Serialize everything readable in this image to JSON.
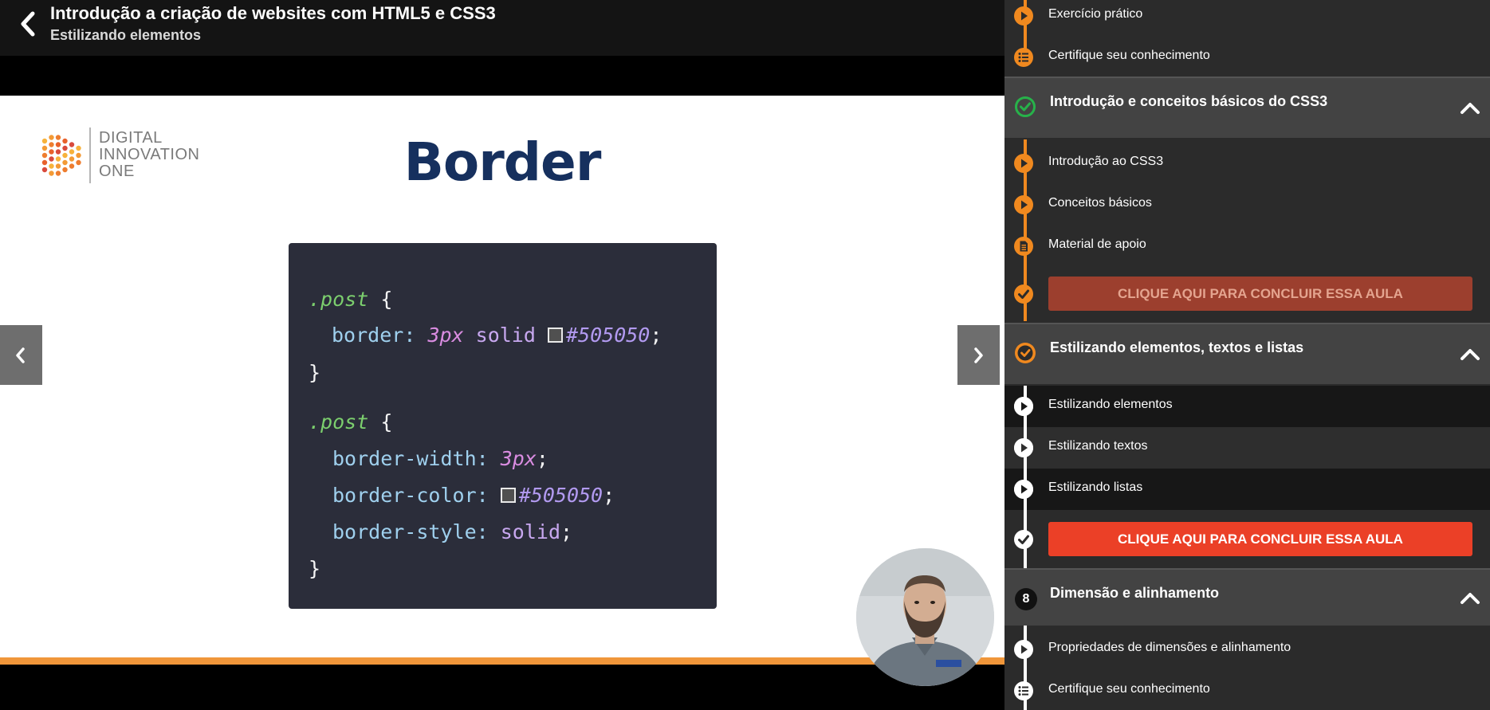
{
  "header": {
    "course_title": "Introdução a criação de websites com HTML5 e CSS3",
    "lesson_subtitle": "Estilizando elementos"
  },
  "slide": {
    "logo_lines": [
      "DIGITAL",
      "INNOVATION",
      "ONE"
    ],
    "heading": "Border",
    "code": {
      "block1_selector": ".post",
      "open_brace": "{",
      "close_brace": "}",
      "line_border_prop": "border",
      "line_border_num": "3px",
      "line_border_style": "solid",
      "line_border_hex": "#505050",
      "block2_selector": ".post",
      "width_prop": "border-width",
      "width_val": "3px",
      "color_prop": "border-color",
      "color_hex": "#505050",
      "style_prop": "border-style",
      "style_val": "solid",
      "colon": ":",
      "semicolon": ";"
    }
  },
  "sidebar": {
    "items_top": [
      {
        "label": "Exercício prático",
        "icon": "play-icon"
      },
      {
        "label": "Certifique seu conhecimento",
        "icon": "list-icon"
      }
    ],
    "section_css3": {
      "title": "Introdução e conceitos básicos do CSS3",
      "icon": "check-circle-icon",
      "items": [
        {
          "label": "Introdução ao CSS3",
          "icon": "play-icon"
        },
        {
          "label": "Conceitos básicos",
          "icon": "play-icon"
        },
        {
          "label": "Material de apoio",
          "icon": "document-icon"
        }
      ],
      "cta": "CLIQUE AQUI PARA CONCLUIR ESSA AULA"
    },
    "section_estilizando": {
      "title": "Estilizando elementos, textos e listas",
      "icon": "check-circle-icon",
      "items": [
        {
          "label": "Estilizando elementos",
          "icon": "play-icon"
        },
        {
          "label": "Estilizando textos",
          "icon": "play-icon"
        },
        {
          "label": "Estilizando listas",
          "icon": "play-icon"
        }
      ],
      "cta": "CLIQUE AQUI PARA CONCLUIR ESSA AULA"
    },
    "section_dimensao": {
      "number": "8",
      "title": "Dimensão e alinhamento",
      "items": [
        {
          "label": "Propriedades de dimensões e alinhamento",
          "icon": "play-icon"
        },
        {
          "label": "Certifique seu conhecimento",
          "icon": "list-icon"
        }
      ]
    }
  },
  "colors": {
    "accent_orange": "#f0891f",
    "cta_active": "#eb4027",
    "cta_done": "#9c3f2e",
    "heading_navy": "#16305e"
  }
}
